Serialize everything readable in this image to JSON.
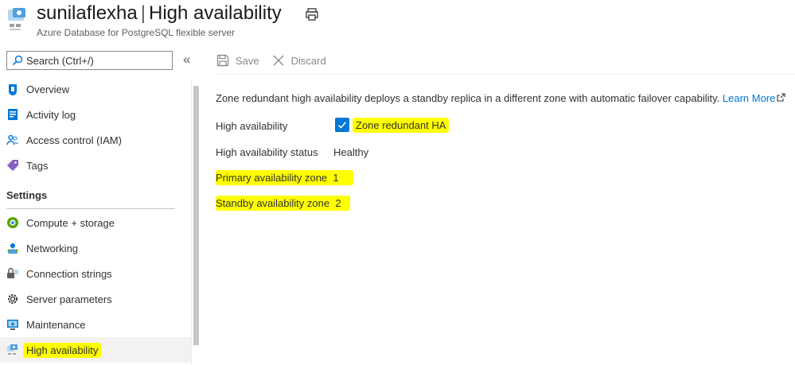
{
  "header": {
    "resource_name": "sunilaflexha",
    "separator": "|",
    "page_name": "High availability",
    "subtitle": "Azure Database for PostgreSQL flexible server"
  },
  "sidebar": {
    "search_placeholder": "Search (Ctrl+/)",
    "collapse_label": "«",
    "items": [
      {
        "label": "Overview",
        "icon": "postgres-elephant-icon"
      },
      {
        "label": "Activity log",
        "icon": "activity-log-icon"
      },
      {
        "label": "Access control (IAM)",
        "icon": "iam-people-icon"
      },
      {
        "label": "Tags",
        "icon": "tag-icon"
      }
    ],
    "settings_heading": "Settings",
    "settings_items": [
      {
        "label": "Compute + storage",
        "icon": "compute-storage-icon"
      },
      {
        "label": "Networking",
        "icon": "networking-icon"
      },
      {
        "label": "Connection strings",
        "icon": "connection-strings-icon"
      },
      {
        "label": "Server parameters",
        "icon": "gear-icon"
      },
      {
        "label": "Maintenance",
        "icon": "maintenance-icon"
      },
      {
        "label": "High availability",
        "icon": "high-availability-icon",
        "active": true
      }
    ]
  },
  "toolbar": {
    "save_label": "Save",
    "discard_label": "Discard"
  },
  "content": {
    "description": "Zone redundant high availability deploys a standby replica in a different zone with automatic failover capability.",
    "learn_more": "Learn More",
    "ha_label": "High availability",
    "ha_checkbox_label": "Zone redundant HA",
    "ha_checked": true,
    "status_label": "High availability status",
    "status_value": "Healthy",
    "primary_zone_label": "Primary availability zone",
    "primary_zone_value": "1",
    "standby_zone_label": "Standby availability zone",
    "standby_zone_value": "2"
  },
  "colors": {
    "accent": "#0078d4",
    "highlight": "#ffff00"
  }
}
